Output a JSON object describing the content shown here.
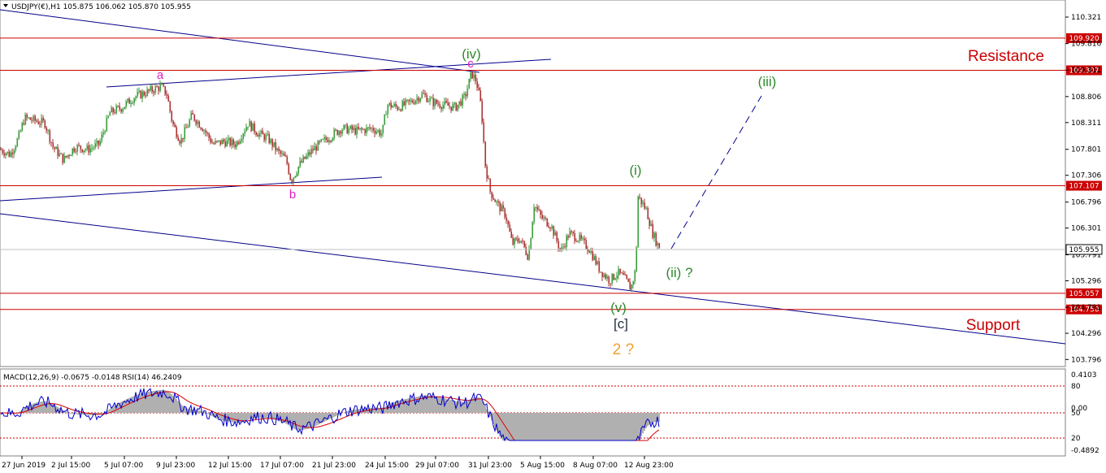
{
  "chart_data": {
    "type": "candlestick",
    "symbol_header": "USDJPY(€),H1  105.875 106.062 105.870 105.955",
    "current_price": "105.955",
    "y_ticks": [
      "110.321",
      "109.816",
      "109.311",
      "108.806",
      "108.311",
      "107.801",
      "107.306",
      "106.796",
      "106.301",
      "105.791",
      "105.296",
      "104.791",
      "104.296",
      "103.796"
    ],
    "x_ticks": [
      "27 Jun 2019",
      "2 Jul 15:00",
      "5 Jul 07:00",
      "9 Jul 23:00",
      "12 Jul 15:00",
      "17 Jul 07:00",
      "21 Jul 23:00",
      "24 Jul 15:00",
      "29 Jul 07:00",
      "31 Jul 23:00",
      "5 Aug 15:00",
      "8 Aug 07:00",
      "12 Aug 23:00"
    ],
    "price_range": [
      103.6,
      110.6
    ],
    "levels": [
      {
        "price": 109.92,
        "label": "109.920"
      },
      {
        "price": 109.307,
        "label": "109.307"
      },
      {
        "price": 107.107,
        "label": "107.107"
      },
      {
        "price": 105.057,
        "label": "105.057"
      },
      {
        "price": 104.75,
        "label": "104.750"
      }
    ],
    "annotations": {
      "resistance": "Resistance",
      "support": "Support",
      "a": "a",
      "b": "b",
      "c": "c",
      "iv": "(iv)",
      "iii": "(iii)",
      "i": "(i)",
      "ii": "(ii) ?",
      "v": "(v)",
      "c_bracket": "[c]",
      "two": "2 ?"
    },
    "price_path": [
      {
        "x": 0,
        "p": 107.8
      },
      {
        "x": 12,
        "p": 107.7
      },
      {
        "x": 22,
        "p": 108.0
      },
      {
        "x": 30,
        "p": 108.4
      },
      {
        "x": 42,
        "p": 108.35
      },
      {
        "x": 55,
        "p": 108.3
      },
      {
        "x": 65,
        "p": 107.85
      },
      {
        "x": 78,
        "p": 107.6
      },
      {
        "x": 92,
        "p": 107.85
      },
      {
        "x": 108,
        "p": 107.8
      },
      {
        "x": 122,
        "p": 107.9
      },
      {
        "x": 135,
        "p": 108.5
      },
      {
        "x": 150,
        "p": 108.6
      },
      {
        "x": 165,
        "p": 108.8
      },
      {
        "x": 182,
        "p": 108.9
      },
      {
        "x": 198,
        "p": 109.0
      },
      {
        "x": 205,
        "p": 108.85
      },
      {
        "x": 212,
        "p": 108.3
      },
      {
        "x": 222,
        "p": 107.95
      },
      {
        "x": 236,
        "p": 108.45
      },
      {
        "x": 250,
        "p": 108.2
      },
      {
        "x": 262,
        "p": 107.9
      },
      {
        "x": 275,
        "p": 107.95
      },
      {
        "x": 290,
        "p": 107.9
      },
      {
        "x": 305,
        "p": 108.3
      },
      {
        "x": 318,
        "p": 108.1
      },
      {
        "x": 330,
        "p": 108.0
      },
      {
        "x": 342,
        "p": 107.75
      },
      {
        "x": 352,
        "p": 107.6
      },
      {
        "x": 358,
        "p": 107.2
      },
      {
        "x": 368,
        "p": 107.5
      },
      {
        "x": 385,
        "p": 107.8
      },
      {
        "x": 402,
        "p": 108.0
      },
      {
        "x": 420,
        "p": 108.2
      },
      {
        "x": 440,
        "p": 108.15
      },
      {
        "x": 458,
        "p": 108.2
      },
      {
        "x": 470,
        "p": 108.1
      },
      {
        "x": 476,
        "p": 108.65
      },
      {
        "x": 490,
        "p": 108.6
      },
      {
        "x": 505,
        "p": 108.7
      },
      {
        "x": 520,
        "p": 108.85
      },
      {
        "x": 532,
        "p": 108.7
      },
      {
        "x": 545,
        "p": 108.65
      },
      {
        "x": 560,
        "p": 108.6
      },
      {
        "x": 572,
        "p": 108.8
      },
      {
        "x": 580,
        "p": 109.25
      },
      {
        "x": 586,
        "p": 109.1
      },
      {
        "x": 592,
        "p": 108.6
      },
      {
        "x": 597,
        "p": 107.5
      },
      {
        "x": 603,
        "p": 107.0
      },
      {
        "x": 612,
        "p": 106.75
      },
      {
        "x": 622,
        "p": 106.55
      },
      {
        "x": 630,
        "p": 106.0
      },
      {
        "x": 640,
        "p": 106.1
      },
      {
        "x": 650,
        "p": 105.75
      },
      {
        "x": 657,
        "p": 106.75
      },
      {
        "x": 666,
        "p": 106.5
      },
      {
        "x": 678,
        "p": 106.35
      },
      {
        "x": 690,
        "p": 105.85
      },
      {
        "x": 700,
        "p": 106.2
      },
      {
        "x": 712,
        "p": 106.1
      },
      {
        "x": 725,
        "p": 105.9
      },
      {
        "x": 738,
        "p": 105.5
      },
      {
        "x": 750,
        "p": 105.3
      },
      {
        "x": 760,
        "p": 105.45
      },
      {
        "x": 768,
        "p": 105.35
      },
      {
        "x": 776,
        "p": 105.15
      },
      {
        "x": 782,
        "p": 105.5
      },
      {
        "x": 785,
        "p": 106.9
      },
      {
        "x": 795,
        "p": 106.65
      },
      {
        "x": 803,
        "p": 106.2
      },
      {
        "x": 810,
        "p": 105.95
      }
    ],
    "macd_axis": [
      "0.4103",
      "0.00",
      "-0.4892"
    ],
    "rsi_axis": [
      "80",
      "50",
      "20"
    ],
    "indicator_header": "MACD(12,26,9) -0.0675 -0.0148  RSI(14) 46.2409"
  },
  "colors": {
    "up": "#3a9a3a",
    "down": "#a83232",
    "level": "#cc0000",
    "trend": "#00008b",
    "pink": "#e020c0",
    "green": "#2e8b2e",
    "orange": "#f0a030",
    "dark": "#1f2f3f",
    "grid": "#c0c0c0"
  }
}
